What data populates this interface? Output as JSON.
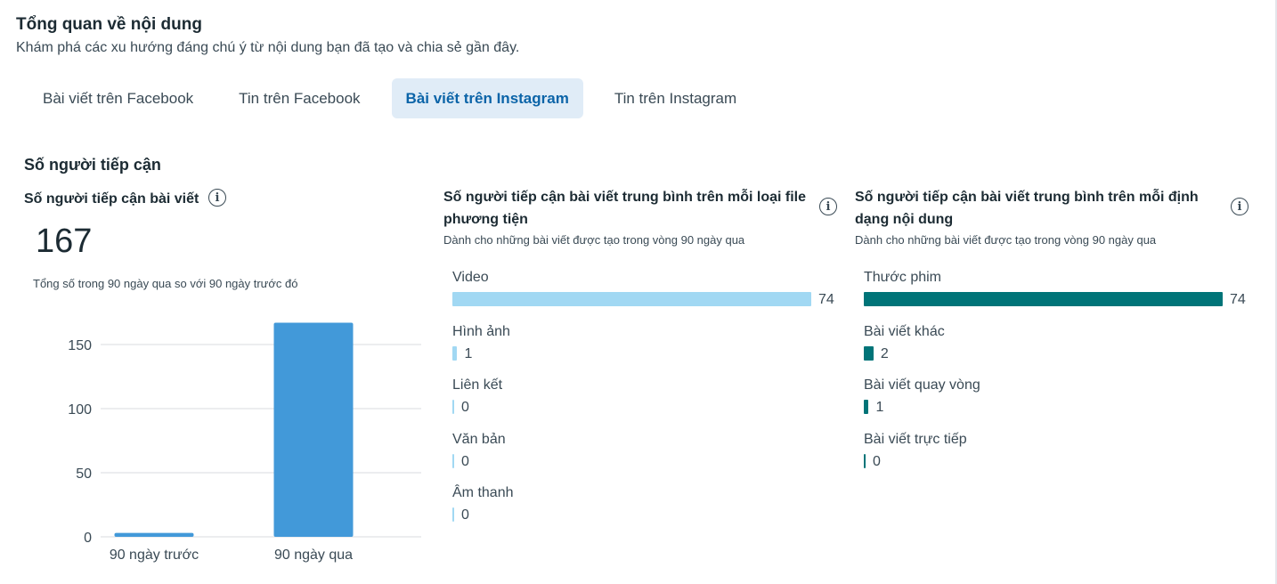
{
  "header": {
    "title": "Tổng quan về nội dung",
    "subtitle": "Khám phá các xu hướng đáng chú ý từ nội dung bạn đã tạo và chia sẻ gần đây."
  },
  "tabs": [
    {
      "label": "Bài viết trên Facebook",
      "active": false
    },
    {
      "label": "Tin trên Facebook",
      "active": false
    },
    {
      "label": "Bài viết trên Instagram",
      "active": true
    },
    {
      "label": "Tin trên Instagram",
      "active": false
    }
  ],
  "section": {
    "title": "Số người tiếp cận"
  },
  "reach_card": {
    "title": "Số người tiếp cận bài viết",
    "total": "167",
    "note": "Tổng số trong 90 ngày qua so với 90 ngày trước đó"
  },
  "media_card": {
    "title": "Số người tiếp cận bài viết trung bình trên mỗi loại file phương tiện",
    "subtitle": "Dành cho những bài viết được tạo trong vòng 90 ngày qua"
  },
  "format_card": {
    "title": "Số người tiếp cận bài viết trung bình trên mỗi định dạng nội dung",
    "subtitle": "Dành cho những bài viết được tạo trong vòng 90 ngày qua"
  },
  "chart_data": [
    {
      "type": "bar",
      "categories": [
        "90 ngày trước",
        "90 ngày qua"
      ],
      "values": [
        3,
        167
      ],
      "yticks": [
        "0",
        "50",
        "100",
        "150"
      ],
      "ylim": [
        0,
        170
      ],
      "grid": true,
      "color": "#4299d9"
    },
    {
      "type": "bar",
      "orientation": "horizontal",
      "categories": [
        "Video",
        "Hình ảnh",
        "Liên kết",
        "Văn bản",
        "Âm thanh"
      ],
      "values": [
        74,
        1,
        0,
        0,
        0
      ],
      "value_labels": [
        "74",
        "1",
        "0",
        "0",
        "0"
      ],
      "color": "#a1d8f3"
    },
    {
      "type": "bar",
      "orientation": "horizontal",
      "categories": [
        "Thước phim",
        "Bài viết khác",
        "Bài viết quay vòng",
        "Bài viết trực tiếp"
      ],
      "values": [
        74,
        2,
        1,
        0
      ],
      "value_labels": [
        "74",
        "2",
        "1",
        "0"
      ],
      "color": "#007478"
    }
  ],
  "icons": {
    "info": "info-icon",
    "info_glyph": "i"
  }
}
